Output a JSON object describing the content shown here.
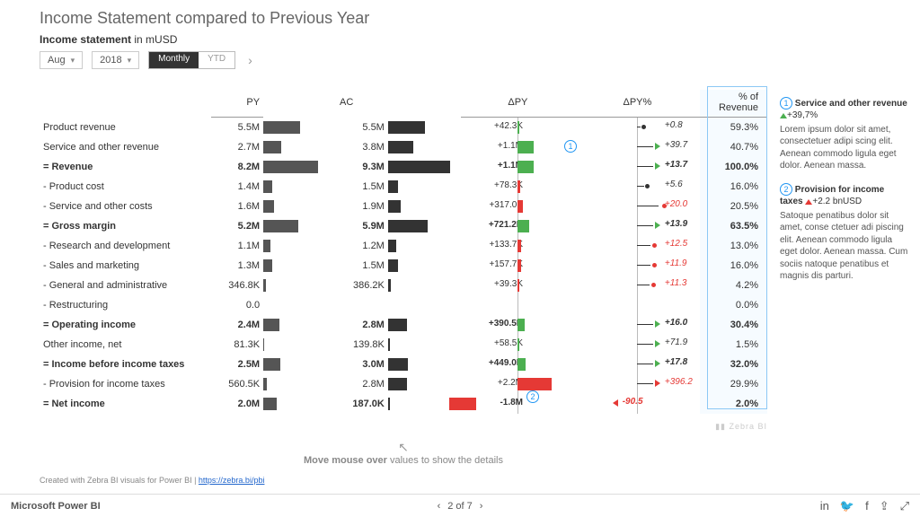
{
  "title": "Income Statement compared to Previous Year",
  "subtitle_bold": "Income statement",
  "subtitle_rest": " in mUSD",
  "controls": {
    "month": "Aug",
    "year": "2018",
    "monthly": "Monthly",
    "ytd": "YTD"
  },
  "headers": {
    "py": "PY",
    "ac": "AC",
    "dpy": "ΔPY",
    "dpyp": "ΔPY%",
    "rev": "% of Revenue"
  },
  "rows": [
    {
      "label": "Product revenue",
      "py": "5.5M",
      "ac": "5.5M",
      "dpy": "+42.3K",
      "dpyp": "+0.8",
      "rev": "59.3%",
      "total": false,
      "pyW": 41,
      "acW": 41,
      "dBar": {
        "c": "green",
        "l": 50,
        "w": 2
      },
      "pin": {
        "x": 53,
        "c": "#333"
      }
    },
    {
      "label": "Service and other revenue",
      "py": "2.7M",
      "ac": "3.8M",
      "dpy": "+1.1M",
      "dpyp": "+39.7",
      "rev": "40.7%",
      "total": false,
      "pyW": 20,
      "acW": 28,
      "dBar": {
        "c": "green",
        "l": 50,
        "w": 18
      },
      "tri": "r",
      "note": 1
    },
    {
      "label": "= Revenue",
      "py": "8.2M",
      "ac": "9.3M",
      "dpy": "+1.1M",
      "dpyp": "+13.7",
      "rev": "100.0%",
      "total": true,
      "pyW": 61,
      "acW": 69,
      "dBar": {
        "c": "green",
        "l": 50,
        "w": 18
      },
      "tri": "r"
    },
    {
      "label": "- Product cost",
      "py": "1.4M",
      "ac": "1.5M",
      "dpy": "+78.3K",
      "dpyp": "+5.6",
      "rev": "16.0%",
      "total": false,
      "pyW": 10,
      "acW": 11,
      "dBar": {
        "c": "red",
        "l": 50,
        "w": 3
      },
      "pin": {
        "x": 56,
        "c": "#333"
      }
    },
    {
      "label": "- Service and other costs",
      "py": "1.6M",
      "ac": "1.9M",
      "dpy": "+317.0K",
      "dpyp": "+20.0",
      "rev": "20.5%",
      "total": false,
      "pyW": 12,
      "acW": 14,
      "dBar": {
        "c": "red",
        "l": 50,
        "w": 6
      },
      "pin": {
        "x": 70,
        "c": "#e53935"
      }
    },
    {
      "label": "= Gross margin",
      "py": "5.2M",
      "ac": "5.9M",
      "dpy": "+721.2K",
      "dpyp": "+13.9",
      "rev": "63.5%",
      "total": true,
      "pyW": 39,
      "acW": 44,
      "dBar": {
        "c": "green",
        "l": 50,
        "w": 13
      },
      "tri": "r"
    },
    {
      "label": "- Research and development",
      "py": "1.1M",
      "ac": "1.2M",
      "dpy": "+133.7K",
      "dpyp": "+12.5",
      "rev": "13.0%",
      "total": false,
      "pyW": 8,
      "acW": 9,
      "dBar": {
        "c": "red",
        "l": 50,
        "w": 4
      },
      "pin": {
        "x": 62,
        "c": "#e53935"
      }
    },
    {
      "label": "- Sales and marketing",
      "py": "1.3M",
      "ac": "1.5M",
      "dpy": "+157.7K",
      "dpyp": "+11.9",
      "rev": "16.0%",
      "total": false,
      "pyW": 10,
      "acW": 11,
      "dBar": {
        "c": "red",
        "l": 50,
        "w": 4
      },
      "pin": {
        "x": 62,
        "c": "#e53935"
      }
    },
    {
      "label": "- General and administrative",
      "py": "346.8K",
      "ac": "386.2K",
      "dpy": "+39.3K",
      "dpyp": "+11.3",
      "rev": "4.2%",
      "total": false,
      "pyW": 3,
      "acW": 3,
      "dBar": {
        "c": "red",
        "l": 50,
        "w": 2
      },
      "pin": {
        "x": 61,
        "c": "#e53935"
      }
    },
    {
      "label": "- Restructuring",
      "py": "0.0",
      "ac": "",
      "dpy": "",
      "dpyp": "",
      "rev": "0.0%",
      "total": false,
      "pyW": 0,
      "acW": 0
    },
    {
      "label": "= Operating income",
      "py": "2.4M",
      "ac": "2.8M",
      "dpy": "+390.5K",
      "dpyp": "+16.0",
      "rev": "30.4%",
      "total": true,
      "pyW": 18,
      "acW": 21,
      "dBar": {
        "c": "green",
        "l": 50,
        "w": 8
      },
      "tri": "r"
    },
    {
      "label": "Other income, net",
      "py": "81.3K",
      "ac": "139.8K",
      "dpy": "+58.5K",
      "dpyp": "+71.9",
      "rev": "1.5%",
      "total": false,
      "pyW": 1,
      "acW": 2,
      "dBar": {
        "c": "green",
        "l": 50,
        "w": 2
      },
      "tri": "r"
    },
    {
      "label": "= Income before income taxes",
      "py": "2.5M",
      "ac": "3.0M",
      "dpy": "+449.0K",
      "dpyp": "+17.8",
      "rev": "32.0%",
      "total": true,
      "pyW": 19,
      "acW": 22,
      "dBar": {
        "c": "green",
        "l": 50,
        "w": 9
      },
      "tri": "r"
    },
    {
      "label": "- Provision for income taxes",
      "py": "560.5K",
      "ac": "2.8M",
      "dpy": "+2.2M",
      "dpyp": "+396.2",
      "rev": "29.9%",
      "total": false,
      "pyW": 4,
      "acW": 21,
      "dBar": {
        "c": "red",
        "l": 50,
        "w": 38
      },
      "tri": "rred",
      "note": 2
    },
    {
      "label": "= Net income",
      "py": "2.0M",
      "ac": "187.0K",
      "dpy": "-1.8M",
      "dpyp": "-90.5",
      "rev": "2.0%",
      "total": true,
      "pyW": 15,
      "acW": 2,
      "dBar": {
        "c": "red",
        "l": 20,
        "w": 30
      },
      "tri": "lred"
    }
  ],
  "hint_bold": "Move mouse over",
  "hint_rest": " values to show the details",
  "credit_text": "Created with Zebra BI visuals for Power BI  |  ",
  "credit_link": "https://zebra.bi/pbi",
  "watermark": "Zebra BI",
  "side": {
    "n1_title": "Service and other revenue",
    "n1_delta": "+39,7%",
    "n1_body": "Lorem ipsum dolor sit amet, consectetuer adipi scing elit. Aenean commodo ligula eget dolor. Aenean massa.",
    "n2_title": "Provision for income taxes",
    "n2_delta": "+2.2 bnUSD",
    "n2_body": "Satoque penatibus dolor sit amet, conse ctetuer adi piscing elit. Aenean commodo ligula eget dolor. Aenean massa. Cum sociis natoque penatibus et magnis dis parturi."
  },
  "footer": {
    "brand": "Microsoft Power BI",
    "page": "2 of 7"
  },
  "chart_data": {
    "type": "table",
    "title": "Income Statement compared to Previous Year",
    "unit": "mUSD",
    "period": {
      "month": "Aug",
      "year": 2018,
      "mode": "Monthly"
    },
    "columns": [
      "PY",
      "AC",
      "ΔPY",
      "ΔPY%",
      "% of Revenue"
    ],
    "series": [
      {
        "name": "Product revenue",
        "PY": 5500000,
        "AC": 5500000,
        "dPY": 42300,
        "dPYp": 0.8,
        "pct_rev": 59.3
      },
      {
        "name": "Service and other revenue",
        "PY": 2700000,
        "AC": 3800000,
        "dPY": 1100000,
        "dPYp": 39.7,
        "pct_rev": 40.7
      },
      {
        "name": "Revenue",
        "PY": 8200000,
        "AC": 9300000,
        "dPY": 1100000,
        "dPYp": 13.7,
        "pct_rev": 100.0,
        "total": true
      },
      {
        "name": "Product cost",
        "PY": 1400000,
        "AC": 1500000,
        "dPY": 78300,
        "dPYp": 5.6,
        "pct_rev": 16.0
      },
      {
        "name": "Service and other costs",
        "PY": 1600000,
        "AC": 1900000,
        "dPY": 317000,
        "dPYp": 20.0,
        "pct_rev": 20.5
      },
      {
        "name": "Gross margin",
        "PY": 5200000,
        "AC": 5900000,
        "dPY": 721200,
        "dPYp": 13.9,
        "pct_rev": 63.5,
        "total": true
      },
      {
        "name": "Research and development",
        "PY": 1100000,
        "AC": 1200000,
        "dPY": 133700,
        "dPYp": 12.5,
        "pct_rev": 13.0
      },
      {
        "name": "Sales and marketing",
        "PY": 1300000,
        "AC": 1500000,
        "dPY": 157700,
        "dPYp": 11.9,
        "pct_rev": 16.0
      },
      {
        "name": "General and administrative",
        "PY": 346800,
        "AC": 386200,
        "dPY": 39300,
        "dPYp": 11.3,
        "pct_rev": 4.2
      },
      {
        "name": "Restructuring",
        "PY": 0,
        "AC": 0,
        "dPY": 0,
        "dPYp": 0,
        "pct_rev": 0.0
      },
      {
        "name": "Operating income",
        "PY": 2400000,
        "AC": 2800000,
        "dPY": 390500,
        "dPYp": 16.0,
        "pct_rev": 30.4,
        "total": true
      },
      {
        "name": "Other income, net",
        "PY": 81300,
        "AC": 139800,
        "dPY": 58500,
        "dPYp": 71.9,
        "pct_rev": 1.5
      },
      {
        "name": "Income before income taxes",
        "PY": 2500000,
        "AC": 3000000,
        "dPY": 449000,
        "dPYp": 17.8,
        "pct_rev": 32.0,
        "total": true
      },
      {
        "name": "Provision for income taxes",
        "PY": 560500,
        "AC": 2800000,
        "dPY": 2200000,
        "dPYp": 396.2,
        "pct_rev": 29.9
      },
      {
        "name": "Net income",
        "PY": 2000000,
        "AC": 187000,
        "dPY": -1800000,
        "dPYp": -90.5,
        "pct_rev": 2.0,
        "total": true
      }
    ]
  }
}
